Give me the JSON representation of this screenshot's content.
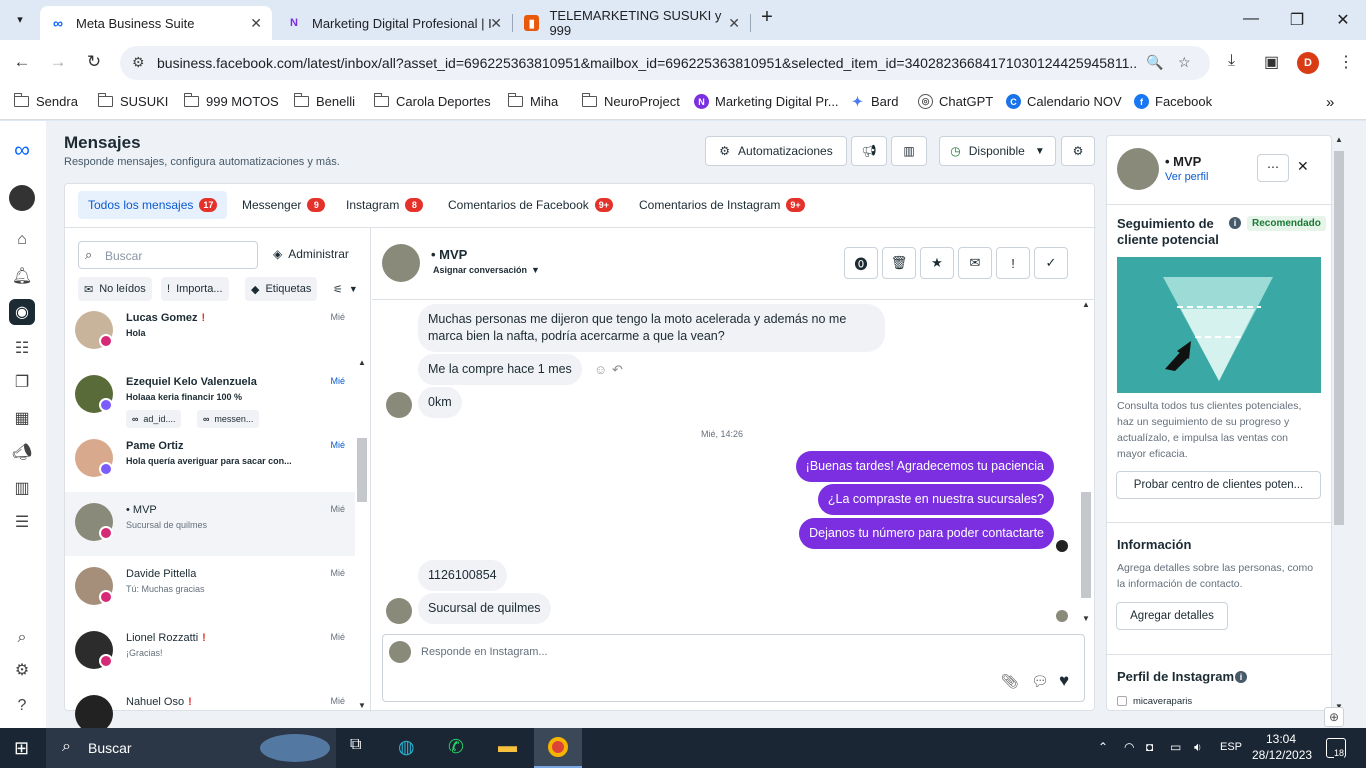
{
  "browser": {
    "tabs": [
      {
        "title": "Meta Business Suite",
        "fav": "meta-logo"
      },
      {
        "title": "Marketing Digital Profesional | I",
        "fav": "nfav"
      },
      {
        "title": "TELEMARKETING SUSUKI y 999",
        "fav": "slides"
      }
    ],
    "url": "business.facebook.com/latest/inbox/all?asset_id=696225363810951&mailbox_id=696225363810951&selected_item_id=34028236684171030124425945811...",
    "profile_initial": "D",
    "bookmarks": [
      "Sendra",
      "SUSUKI",
      "999 MOTOS",
      "Benelli",
      "Carola Deportes",
      "Miha",
      "NeuroProject",
      "Marketing Digital Pr...",
      "Bard",
      "ChatGPT",
      "Calendario NOV",
      "Facebook"
    ]
  },
  "header": {
    "title": "Mensajes",
    "subtitle": "Responde mensajes, configura automatizaciones y más.",
    "automations": "Automatizaciones",
    "status": "Disponible"
  },
  "tabs": [
    {
      "label": "Todos los mensajes",
      "count": "17"
    },
    {
      "label": "Messenger",
      "count": "9"
    },
    {
      "label": "Instagram",
      "count": "8"
    },
    {
      "label": "Comentarios de Facebook",
      "count": "9+"
    },
    {
      "label": "Comentarios de Instagram",
      "count": "9+"
    }
  ],
  "list": {
    "search_placeholder": "Buscar",
    "admin": "Administrar",
    "filters": [
      "No leídos",
      "Importa...",
      "Etiquetas"
    ],
    "conversations": [
      {
        "name": "Lucas Gomez",
        "flag": "!",
        "preview": "Hola",
        "time": "Mié"
      },
      {
        "name": "Ezequiel Kelo Valenzuela",
        "flag": "",
        "preview": "Holaaa keria financir 100 %",
        "time": "Mié",
        "chips": [
          "ad_id....",
          "messen..."
        ]
      },
      {
        "name": "Pame Ortiz",
        "flag": "",
        "preview": "Hola quería averiguar para sacar con...",
        "time": "Mié"
      },
      {
        "name": "• MVP",
        "flag": "",
        "preview": "Sucursal de quilmes",
        "time": "Mié"
      },
      {
        "name": "Davide Pittella",
        "flag": "",
        "preview": "Tú: Muchas gracias",
        "time": "Mié"
      },
      {
        "name": "Lionel Rozzatti",
        "flag": "!",
        "preview": "¡Gracias!",
        "time": "Mié"
      },
      {
        "name": "Nahuel Oso",
        "flag": "!",
        "preview": "",
        "time": "Mié"
      }
    ]
  },
  "chat": {
    "name": "• MVP",
    "assign": "Asignar conversación",
    "messages": [
      {
        "dir": "in",
        "text": "Muchas personas me dijeron que tengo la moto acelerada y además no me marca bien la nafta, podría acercarme a que la vean?"
      },
      {
        "dir": "in",
        "text": "Me la compre hace 1 mes"
      },
      {
        "dir": "in",
        "text": "0km"
      },
      {
        "dir": "out",
        "text": "¡Buenas tardes! Agradecemos tu paciencia"
      },
      {
        "dir": "out",
        "text": "¿La compraste en nuestra sucursales?"
      },
      {
        "dir": "out",
        "text": "Dejanos tu número para poder contactarte"
      },
      {
        "dir": "in",
        "text": "1126100854"
      },
      {
        "dir": "in",
        "text": "Sucursal de quilmes"
      }
    ],
    "timestamp": "Mié, 14:26",
    "composer_placeholder": "Responde en Instagram..."
  },
  "profile": {
    "name": "• MVP",
    "link": "Ver perfil",
    "lead_title": "Seguimiento de cliente potencial",
    "lead_badge": "Recomendado",
    "lead_desc": "Consulta todos tus clientes potenciales, haz un seguimiento de su progreso y actualízalo, e impulsa las ventas con mayor eficacia.",
    "lead_button": "Probar centro de clientes poten...",
    "info_title": "Información",
    "info_desc": "Agrega detalles sobre las personas, como la información de contacto.",
    "info_button": "Agregar detalles",
    "ig_title": "Perfil de Instagram",
    "ig_user": "micaveraparis"
  },
  "taskbar": {
    "search": "Buscar",
    "lang": "ESP",
    "time": "13:04",
    "date": "28/12/2023",
    "notif": "18"
  },
  "colors": {
    "accent": "#0a5cd1",
    "bubble_out": "#7b2fe0",
    "badge": "#e4322b",
    "funnel_bg": "#3aa8a4"
  }
}
